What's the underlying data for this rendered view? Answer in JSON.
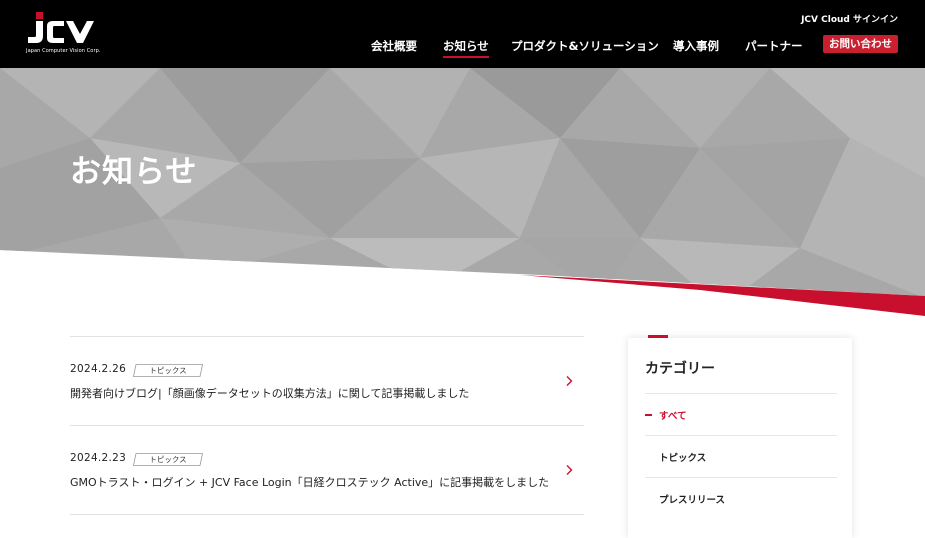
{
  "header": {
    "logo_text": "JCV",
    "logo_subtitle": "Japan Computer Vision Corp.",
    "signin_label": "JCV Cloud サインイン",
    "nav": [
      {
        "label": "会社概要"
      },
      {
        "label": "お知らせ"
      },
      {
        "label": "プロダクト&ソリューション"
      },
      {
        "label": "導入事例"
      },
      {
        "label": "パートナー"
      }
    ],
    "contact_label": "お問い合わせ"
  },
  "hero": {
    "title": "お知らせ"
  },
  "news": [
    {
      "date": "2024.2.26",
      "tag": "トピックス",
      "title": "開発者向けブログ|「顔画像データセットの収集方法」に関して記事掲載しました"
    },
    {
      "date": "2024.2.23",
      "tag": "トピックス",
      "title": "GMOトラスト・ログイン + JCV Face Login「日経クロステック Active」に記事掲載をしました"
    }
  ],
  "sidebar": {
    "title": "カテゴリー",
    "items": [
      {
        "label": "すべて"
      },
      {
        "label": "トピックス"
      },
      {
        "label": "プレスリリース"
      }
    ]
  },
  "colors": {
    "accent": "#c8102e",
    "header_bg": "#000000",
    "hero_gray": "#a9a9a9"
  },
  "icons": [
    "chevron-right-icon"
  ]
}
